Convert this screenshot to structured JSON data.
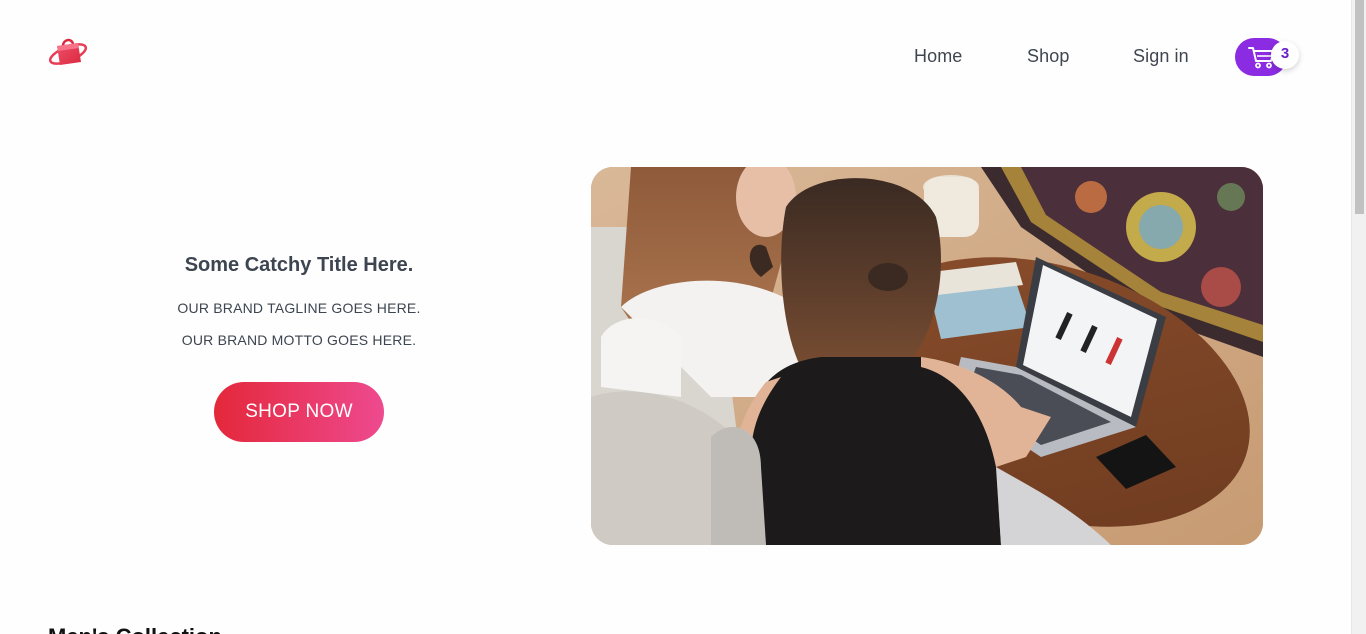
{
  "nav": {
    "home": "Home",
    "shop": "Shop",
    "signin": "Sign in"
  },
  "cart": {
    "count": "3",
    "icon": "cart-icon"
  },
  "hero": {
    "title": "Some Catchy Title Here.",
    "tagline": "OUR BRAND TAGLINE GOES HERE.",
    "motto": "OUR BRAND MOTTO GOES HERE.",
    "cta": "SHOP NOW"
  },
  "section": {
    "heading": "Men's Collection"
  },
  "colors": {
    "accent_purple": "#8b2be2",
    "cta_gradient_start": "#e4283a",
    "cta_gradient_end": "#ee4a8f",
    "text": "#3d4550"
  }
}
